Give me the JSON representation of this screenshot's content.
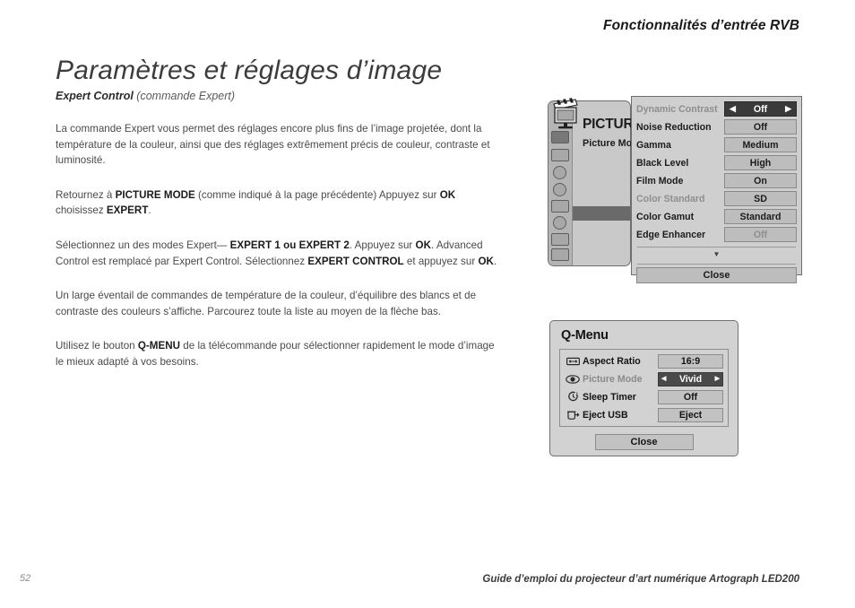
{
  "running_head": "Fonctionnalités d’entrée RVB",
  "page_title": "Paramètres et réglages d’image",
  "section": {
    "head_bold": "Expert Control",
    "head_italic": "(commande Expert)"
  },
  "paragraphs": {
    "p1_a": "La commande Expert vous permet des réglages encore plus fins de l’image projetée, dont la température de la couleur, ainsi que des réglages extrêmement précis de couleur, contraste et luminosité.",
    "p2_a": "Retournez à ",
    "p2_b1": "PICTURE MODE",
    "p2_c": " (comme indiqué à la page précédente) Appuyez sur ",
    "p2_b2": "OK",
    "p2_d": " choisissez ",
    "p2_b3": "EXPERT",
    "p2_e": ".",
    "p3_a": "Sélectionnez un des modes Expert— ",
    "p3_b1": "EXPERT 1 ou EXPERT 2",
    "p3_c": ". Appuyez sur ",
    "p3_b2": "OK",
    "p3_d": ". Advanced Control est remplacé par Expert Control. Sélectionnez ",
    "p3_b3": "EXPERT CONTROL",
    "p3_e": " et appuyez sur ",
    "p3_b4": "OK",
    "p3_f": ".",
    "p4_a": "Un large éventail de commandes de température de la couleur, d’équilibre des blancs et de contraste des couleurs s’affiche. Parcourez toute la liste au moyen de la flèche bas.",
    "p5_a": "Utilisez le bouton ",
    "p5_b1": "Q-MENU",
    "p5_c": " de la télécommande pour sélectionner rapidement le mode d’image le mieux adapté à vos besoins."
  },
  "footer": {
    "folio": "52",
    "title": "Guide d’emploi du projecteur d’art numérique Artograph LED200"
  },
  "osd_picture": {
    "menu_title": "PICTURE",
    "submenu_label": "Picture Mod",
    "rows": [
      {
        "label": "Dynamic Contrast",
        "value": "Off",
        "state": "active",
        "arrow_left": "◀",
        "arrow_right": "▶"
      },
      {
        "label": "Noise Reduction",
        "value": "Off",
        "state": "normal"
      },
      {
        "label": "Gamma",
        "value": "Medium",
        "state": "normal"
      },
      {
        "label": "Black Level",
        "value": "High",
        "state": "normal"
      },
      {
        "label": "Film Mode",
        "value": "On",
        "state": "normal"
      },
      {
        "label": "Color Standard",
        "value": "SD",
        "state": "label-dim"
      },
      {
        "label": "Color Gamut",
        "value": "Standard",
        "state": "normal"
      },
      {
        "label": "Edge Enhancer",
        "value": "Off",
        "state": "value-dim"
      }
    ],
    "scroll_glyph": "▼",
    "close_label": "Close",
    "icons": {
      "header": "tv-clapperboard-icon",
      "rail": [
        "picture-icon",
        "screen-icon",
        "audio-icon",
        "time-icon",
        "lock-icon",
        "option-icon",
        "input-icon",
        "usb-icon"
      ]
    }
  },
  "qmenu": {
    "title": "Q-Menu",
    "rows": [
      {
        "icon": "aspect-ratio-icon",
        "label": "Aspect Ratio",
        "value": "16:9",
        "state": "normal"
      },
      {
        "icon": "eye-icon",
        "label": "Picture Mode",
        "value": "Vivid",
        "state": "active",
        "arrow_left": "◀",
        "arrow_right": "▶"
      },
      {
        "icon": "sleep-timer-icon",
        "label": "Sleep Timer",
        "value": "Off",
        "state": "normal"
      },
      {
        "icon": "eject-usb-icon",
        "label": "Eject USB",
        "value": "Eject",
        "state": "normal"
      }
    ],
    "close_label": "Close"
  },
  "colors": {
    "page_bg": "#ffffff",
    "text": "#4a4a4a",
    "heading": "#3c3c3c",
    "osd_panel": "#cfcfcf",
    "osd_value": "#bdbdbd",
    "osd_active": "#3a3a3a",
    "rail": "#b4b4b4",
    "highlight_bar": "#6a6a6a"
  }
}
